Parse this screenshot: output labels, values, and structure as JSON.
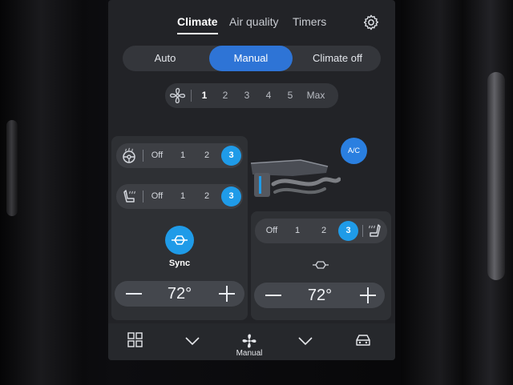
{
  "tabs": [
    {
      "label": "Climate",
      "active": true
    },
    {
      "label": "Air quality",
      "active": false
    },
    {
      "label": "Timers",
      "active": false
    }
  ],
  "settings_icon": "gear-icon",
  "mode": {
    "options": [
      {
        "label": "Auto",
        "active": false
      },
      {
        "label": "Manual",
        "active": true
      },
      {
        "label": "Climate off",
        "active": false
      }
    ],
    "accent_color": "#2e74d6"
  },
  "fan": {
    "icon": "fan-icon",
    "levels": [
      "1",
      "2",
      "3",
      "4",
      "5",
      "Max"
    ],
    "selected": "1"
  },
  "ac_button": {
    "label": "A/C",
    "color": "#2a7fe0"
  },
  "driver": {
    "steering_heat": {
      "icon": "steering-wheel-heat-icon",
      "levels": [
        "Off",
        "1",
        "2",
        "3"
      ],
      "selected": "3"
    },
    "seat_heat": {
      "icon": "seat-heat-icon",
      "levels": [
        "Off",
        "1",
        "2",
        "3"
      ],
      "selected": "3"
    },
    "sync": {
      "label": "Sync",
      "icon": "sync-icon",
      "active": true
    },
    "temperature": "72°"
  },
  "passenger": {
    "seat_heat": {
      "icon": "seat-heat-icon",
      "levels": [
        "Off",
        "1",
        "2",
        "3"
      ],
      "selected": "3"
    },
    "sync_icon": "sync-icon",
    "temperature": "72°"
  },
  "bottom_bar": {
    "apps_icon": "grid-icon",
    "chevron_icon": "chevron-down-icon",
    "fan_icon": "fan-icon",
    "fan_label": "Manual",
    "car_icon": "car-icon"
  },
  "colors": {
    "active_level": "#1f9be8",
    "screen_bg": "#222327"
  }
}
